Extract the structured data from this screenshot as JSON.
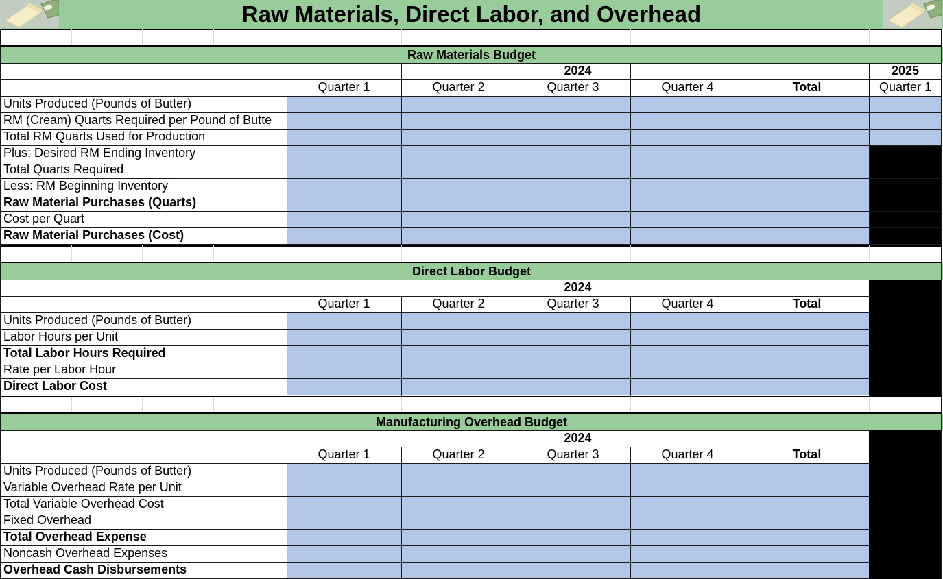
{
  "title": "Raw Materials, Direct Labor, and Overhead",
  "colors": {
    "header_green": "#98cc9a",
    "input_blue": "#b4c6e7",
    "blocked": "#000000"
  },
  "icons": [
    "butter-image-icon"
  ],
  "raw_materials": {
    "title": "Raw Materials Budget",
    "year_main": "2024",
    "year_next": "2025",
    "columns": [
      "Quarter 1",
      "Quarter 2",
      "Quarter 3",
      "Quarter 4",
      "Total"
    ],
    "next_column": "Quarter 1",
    "rows": [
      "Units Produced (Pounds of Butter)",
      "RM (Cream) Quarts Required per Pound of Butte",
      "Total RM Quarts Used for Production",
      "Plus: Desired RM Ending Inventory",
      "Total Quarts Required",
      "Less: RM Beginning Inventory",
      "Raw Material Purchases (Quarts)",
      "Cost per Quart",
      "Raw Material Purchases (Cost)"
    ]
  },
  "direct_labor": {
    "title": "Direct Labor Budget",
    "year_main": "2024",
    "columns": [
      "Quarter 1",
      "Quarter 2",
      "Quarter 3",
      "Quarter 4",
      "Total"
    ],
    "rows": [
      "Units Produced (Pounds of Butter)",
      "Labor Hours per Unit",
      "Total Labor Hours Required",
      "Rate per Labor Hour",
      "Direct Labor Cost"
    ]
  },
  "overhead": {
    "title": "Manufacturing Overhead Budget",
    "year_main": "2024",
    "columns": [
      "Quarter 1",
      "Quarter 2",
      "Quarter 3",
      "Quarter 4",
      "Total"
    ],
    "rows": [
      "Units Produced (Pounds of Butter)",
      "Variable Overhead Rate per Unit",
      "Total Variable Overhead Cost",
      "Fixed Overhead",
      "Total Overhead Expense",
      "Noncash Overhead Expenses",
      "Overhead Cash Disbursements"
    ]
  }
}
